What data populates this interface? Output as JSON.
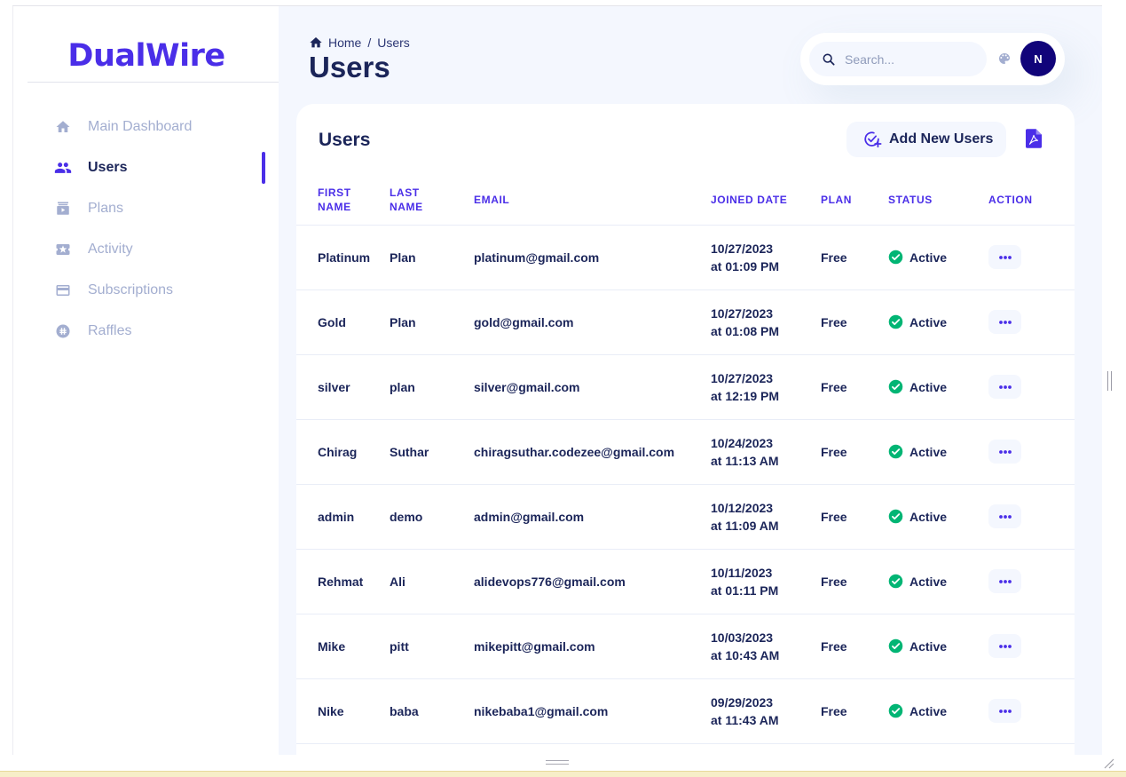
{
  "brand": {
    "logo": "DualWire",
    "accent": "#4a2ee8",
    "text": "#1b2559",
    "muted": "#a3aed0"
  },
  "sidebar": {
    "items": [
      {
        "label": "Main Dashboard",
        "icon": "home-icon",
        "active": false
      },
      {
        "label": "Users",
        "icon": "users-icon",
        "active": true
      },
      {
        "label": "Plans",
        "icon": "plans-icon",
        "active": false
      },
      {
        "label": "Activity",
        "icon": "ticket-icon",
        "active": false
      },
      {
        "label": "Subscriptions",
        "icon": "card-icon",
        "active": false
      },
      {
        "label": "Raffles",
        "icon": "raffle-icon",
        "active": false
      }
    ]
  },
  "header": {
    "breadcrumb_home": "Home",
    "breadcrumb_sep": "/",
    "breadcrumb_current": "Users",
    "title": "Users",
    "search_placeholder": "Search...",
    "avatar_initial": "N"
  },
  "card": {
    "title": "Users",
    "add_button_label": "Add New Users",
    "columns": [
      "FIRST NAME",
      "LAST NAME",
      "EMAIL",
      "JOINED DATE",
      "PLAN",
      "STATUS",
      "ACTION"
    ],
    "rows": [
      {
        "first": "Platinum",
        "last": "Plan",
        "email": "platinum@gmail.com",
        "date": "10/27/2023",
        "time": "at 01:09 PM",
        "plan": "Free",
        "status": "Active"
      },
      {
        "first": "Gold",
        "last": "Plan",
        "email": "gold@gmail.com",
        "date": "10/27/2023",
        "time": "at 01:08 PM",
        "plan": "Free",
        "status": "Active"
      },
      {
        "first": "silver",
        "last": "plan",
        "email": "silver@gmail.com",
        "date": "10/27/2023",
        "time": "at 12:19 PM",
        "plan": "Free",
        "status": "Active"
      },
      {
        "first": "Chirag",
        "last": "Suthar",
        "email": "chiragsuthar.codezee@gmail.com",
        "date": "10/24/2023",
        "time": "at 11:13 AM",
        "plan": "Free",
        "status": "Active"
      },
      {
        "first": "admin",
        "last": "demo",
        "email": "admin@gmail.com",
        "date": "10/12/2023",
        "time": "at 11:09 AM",
        "plan": "Free",
        "status": "Active"
      },
      {
        "first": "Rehmat",
        "last": "Ali",
        "email": "alidevops776@gmail.com",
        "date": "10/11/2023",
        "time": "at 01:11 PM",
        "plan": "Free",
        "status": "Active"
      },
      {
        "first": "Mike",
        "last": "pitt",
        "email": "mikepitt@gmail.com",
        "date": "10/03/2023",
        "time": "at 10:43 AM",
        "plan": "Free",
        "status": "Active"
      },
      {
        "first": "Nike",
        "last": "baba",
        "email": "nikebaba1@gmail.com",
        "date": "09/29/2023",
        "time": "at 11:43 AM",
        "plan": "Free",
        "status": "Active"
      }
    ],
    "status_color": "#01b574"
  }
}
